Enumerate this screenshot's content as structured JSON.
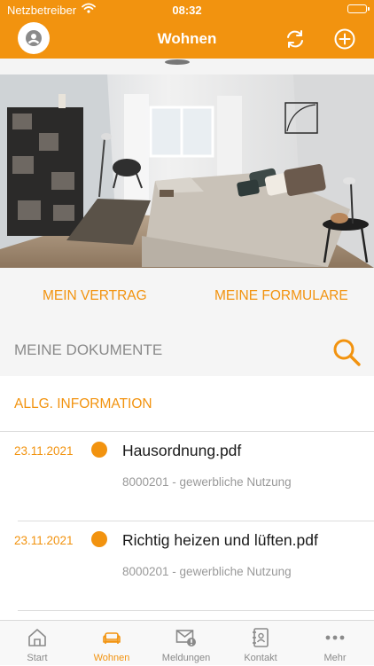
{
  "status_bar": {
    "carrier": "Netzbetreiber",
    "time": "08:32"
  },
  "nav": {
    "title": "Wohnen"
  },
  "segments": {
    "left": "MEIN VERTRAG",
    "right": "MEINE FORMULARE"
  },
  "search": {
    "label": "MEINE DOKUMENTE"
  },
  "section": {
    "label": "ALLG. INFORMATION"
  },
  "documents": [
    {
      "date": "23.11.2021",
      "name": "Hausordnung.pdf",
      "sub": "8000201 - gewerbliche Nutzung"
    },
    {
      "date": "23.11.2021",
      "name": "Richtig heizen und lüften.pdf",
      "sub": "8000201 - gewerbliche Nutzung"
    }
  ],
  "tabs": [
    {
      "label": "Start",
      "icon": "home-icon"
    },
    {
      "label": "Wohnen",
      "icon": "sofa-icon",
      "active": true
    },
    {
      "label": "Meldungen",
      "icon": "mail-alert-icon"
    },
    {
      "label": "Kontakt",
      "icon": "contact-book-icon"
    },
    {
      "label": "Mehr",
      "icon": "more-dots-icon"
    }
  ],
  "colors": {
    "accent": "#f2930f",
    "background_grey": "#f5f5f5"
  }
}
